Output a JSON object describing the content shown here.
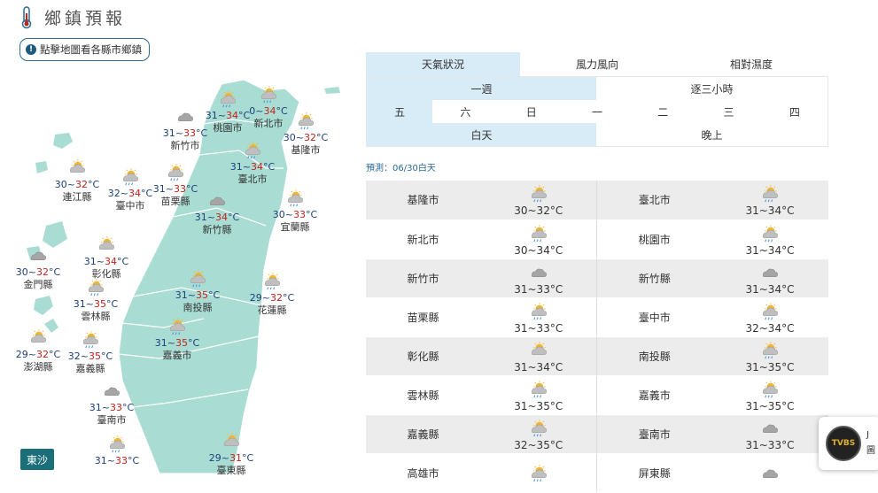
{
  "header": {
    "title": "鄉鎮預報",
    "icon": "thermometer-icon"
  },
  "map_tip": {
    "text": "點擊地圖看各縣市鄉鎮"
  },
  "map": {
    "dongsha_label": "東沙",
    "cities": [
      {
        "name": "連江縣",
        "lo": "30",
        "hi": "32",
        "unit": "°C",
        "icon": "partly-cloudy"
      },
      {
        "name": "臺中市",
        "lo": "32",
        "hi": "34",
        "unit": "°C",
        "icon": "sun-rain"
      },
      {
        "name": "苗栗縣",
        "lo": "31",
        "hi": "33",
        "unit": "°C",
        "icon": "sun-rain"
      },
      {
        "name": "新竹市",
        "lo": "31",
        "hi": "33",
        "unit": "°C",
        "icon": "cloudy"
      },
      {
        "name": "桃園市",
        "lo": "31",
        "hi": "34",
        "unit": "°C",
        "icon": "sun-rain"
      },
      {
        "name": "新北市",
        "lo": "0",
        "hi": "34",
        "unit": "°C",
        "icon": "sun-rain"
      },
      {
        "name": "基隆市",
        "lo": "30",
        "hi": "32",
        "unit": "°C",
        "icon": "sun-rain"
      },
      {
        "name": "臺北市",
        "lo": "31",
        "hi": "34",
        "unit": "°C",
        "icon": "sun-rain"
      },
      {
        "name": "新竹縣",
        "lo": "31",
        "hi": "34",
        "unit": "°C",
        "icon": "cloudy"
      },
      {
        "name": "宜蘭縣",
        "lo": "30",
        "hi": "33",
        "unit": "°C",
        "icon": "sun-rain"
      },
      {
        "name": "彰化縣",
        "lo": "31",
        "hi": "34",
        "unit": "°C",
        "icon": "partly-cloudy"
      },
      {
        "name": "金門縣",
        "lo": "30",
        "hi": "32",
        "unit": "°C",
        "icon": "cloudy"
      },
      {
        "name": "南投縣",
        "lo": "31",
        "hi": "35",
        "unit": "°C",
        "icon": "sun-rain"
      },
      {
        "name": "花蓮縣",
        "lo": "29",
        "hi": "32",
        "unit": "°C",
        "icon": "sun-rain"
      },
      {
        "name": "雲林縣",
        "lo": "31",
        "hi": "35",
        "unit": "°C",
        "icon": "sun-rain"
      },
      {
        "name": "嘉義市",
        "lo": "31",
        "hi": "35",
        "unit": "°C",
        "icon": "sun-rain"
      },
      {
        "name": "澎湖縣",
        "lo": "29",
        "hi": "32",
        "unit": "°C",
        "icon": "partly-cloudy"
      },
      {
        "name": "嘉義縣",
        "lo": "32",
        "hi": "35",
        "unit": "°C",
        "icon": "sun-rain"
      },
      {
        "name": "臺南市",
        "lo": "31",
        "hi": "33",
        "unit": "°C",
        "icon": "cloudy"
      },
      {
        "name": "臺東縣",
        "lo": "29",
        "hi": "31",
        "unit": "°C",
        "icon": "partly-cloudy"
      },
      {
        "name": "",
        "lo": "31",
        "hi": "33",
        "unit": "°C",
        "icon": "sun-rain"
      }
    ]
  },
  "tabs": [
    {
      "label": "天氣狀況",
      "active": true
    },
    {
      "label": "風力風向",
      "active": false
    },
    {
      "label": "相對濕度",
      "active": false
    }
  ],
  "range_toggle": {
    "week": "一週",
    "three_hour": "逐三小時"
  },
  "days": [
    "五",
    "六",
    "日",
    "一",
    "二",
    "三",
    "四"
  ],
  "period_toggle": {
    "day": "白天",
    "night": "晚上"
  },
  "forecast_label": "預測：06/30白天",
  "table": [
    [
      {
        "name": "基隆市",
        "temp": "30~32°C",
        "icon": "sun-rain"
      },
      {
        "name": "臺北市",
        "temp": "31~34°C",
        "icon": "sun-rain"
      }
    ],
    [
      {
        "name": "新北市",
        "temp": "30~34°C",
        "icon": "sun-rain"
      },
      {
        "name": "桃園市",
        "temp": "31~34°C",
        "icon": "sun-rain"
      }
    ],
    [
      {
        "name": "新竹市",
        "temp": "31~33°C",
        "icon": "cloudy"
      },
      {
        "name": "新竹縣",
        "temp": "31~34°C",
        "icon": "cloudy"
      }
    ],
    [
      {
        "name": "苗栗縣",
        "temp": "31~33°C",
        "icon": "sun-rain"
      },
      {
        "name": "臺中市",
        "temp": "32~34°C",
        "icon": "sun-rain"
      }
    ],
    [
      {
        "name": "彰化縣",
        "temp": "31~34°C",
        "icon": "partly-cloudy"
      },
      {
        "name": "南投縣",
        "temp": "31~35°C",
        "icon": "sun-rain"
      }
    ],
    [
      {
        "name": "雲林縣",
        "temp": "31~35°C",
        "icon": "sun-rain"
      },
      {
        "name": "嘉義市",
        "temp": "31~35°C",
        "icon": "sun-rain"
      }
    ],
    [
      {
        "name": "嘉義縣",
        "temp": "32~35°C",
        "icon": "sun-rain"
      },
      {
        "name": "臺南市",
        "temp": "31~33°C",
        "icon": "cloudy"
      }
    ],
    [
      {
        "name": "高雄市",
        "temp": "",
        "icon": "sun-rain"
      },
      {
        "name": "屏東縣",
        "temp": "",
        "icon": "cloudy"
      }
    ]
  ],
  "chat_chip": {
    "initial": "J",
    "text": "圖",
    "avatar": "TVBS"
  },
  "colors": {
    "accent": "#2c6e91",
    "tab_active": "#d8ecf8",
    "map_land": "#a9ddd3",
    "hi_temp": "#c2231c",
    "lo_temp": "#1d3f7a"
  }
}
